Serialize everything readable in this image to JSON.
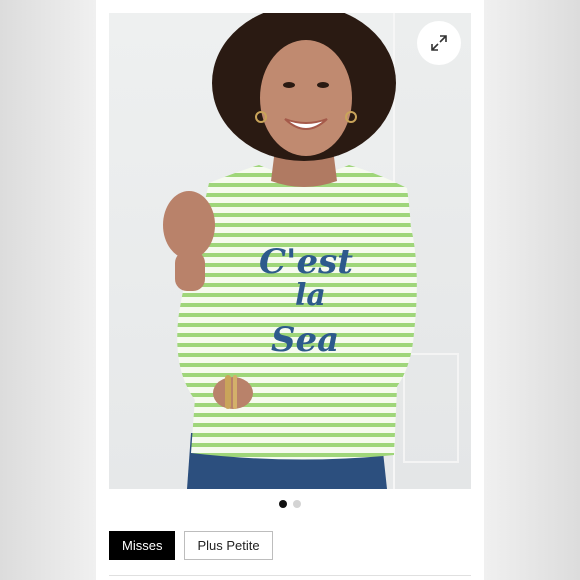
{
  "product": {
    "image_alt_text": "C'est la Sea",
    "shirt_text_lines": [
      "C'est",
      "la",
      "Sea"
    ]
  },
  "gallery": {
    "expand_icon": "expand-arrows-icon",
    "total_images": 2,
    "active_index": 0
  },
  "size_tabs": [
    {
      "label": "Misses",
      "selected": true
    },
    {
      "label": "Plus Petite",
      "selected": false
    }
  ],
  "colors": {
    "stripe_green": "#9fd67a",
    "text_navy": "#2d5a8c",
    "selected_tab": "#000000"
  }
}
